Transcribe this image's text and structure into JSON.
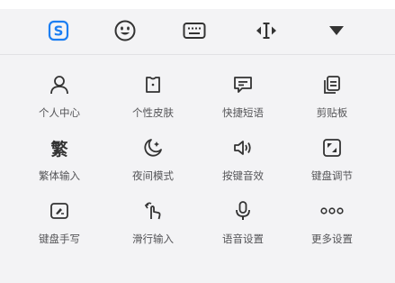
{
  "toolbar": {
    "items": [
      {
        "icon": "sogou-logo-icon",
        "label": "S"
      },
      {
        "icon": "emoji-icon"
      },
      {
        "icon": "keyboard-icon"
      },
      {
        "icon": "cursor-move-icon"
      },
      {
        "icon": "collapse-triangle-icon"
      }
    ]
  },
  "accent": "#1c7ef2",
  "functions": [
    {
      "icon": "person-icon",
      "label": "个人中心"
    },
    {
      "icon": "skin-icon",
      "label": "个性皮肤"
    },
    {
      "icon": "chat-bubble-icon",
      "label": "快捷短语"
    },
    {
      "icon": "clipboard-icon",
      "label": "剪贴板"
    },
    {
      "icon": "traditional-char-icon",
      "glyph": "繁",
      "label": "繁体输入"
    },
    {
      "icon": "moon-icon",
      "label": "夜间模式"
    },
    {
      "icon": "speaker-icon",
      "label": "按键音效"
    },
    {
      "icon": "resize-icon",
      "label": "键盘调节"
    },
    {
      "icon": "handwriting-icon",
      "label": "键盘手写"
    },
    {
      "icon": "swipe-hand-icon",
      "label": "滑行输入"
    },
    {
      "icon": "microphone-icon",
      "label": "语音设置"
    },
    {
      "icon": "more-dots-icon",
      "label": "更多设置"
    }
  ]
}
